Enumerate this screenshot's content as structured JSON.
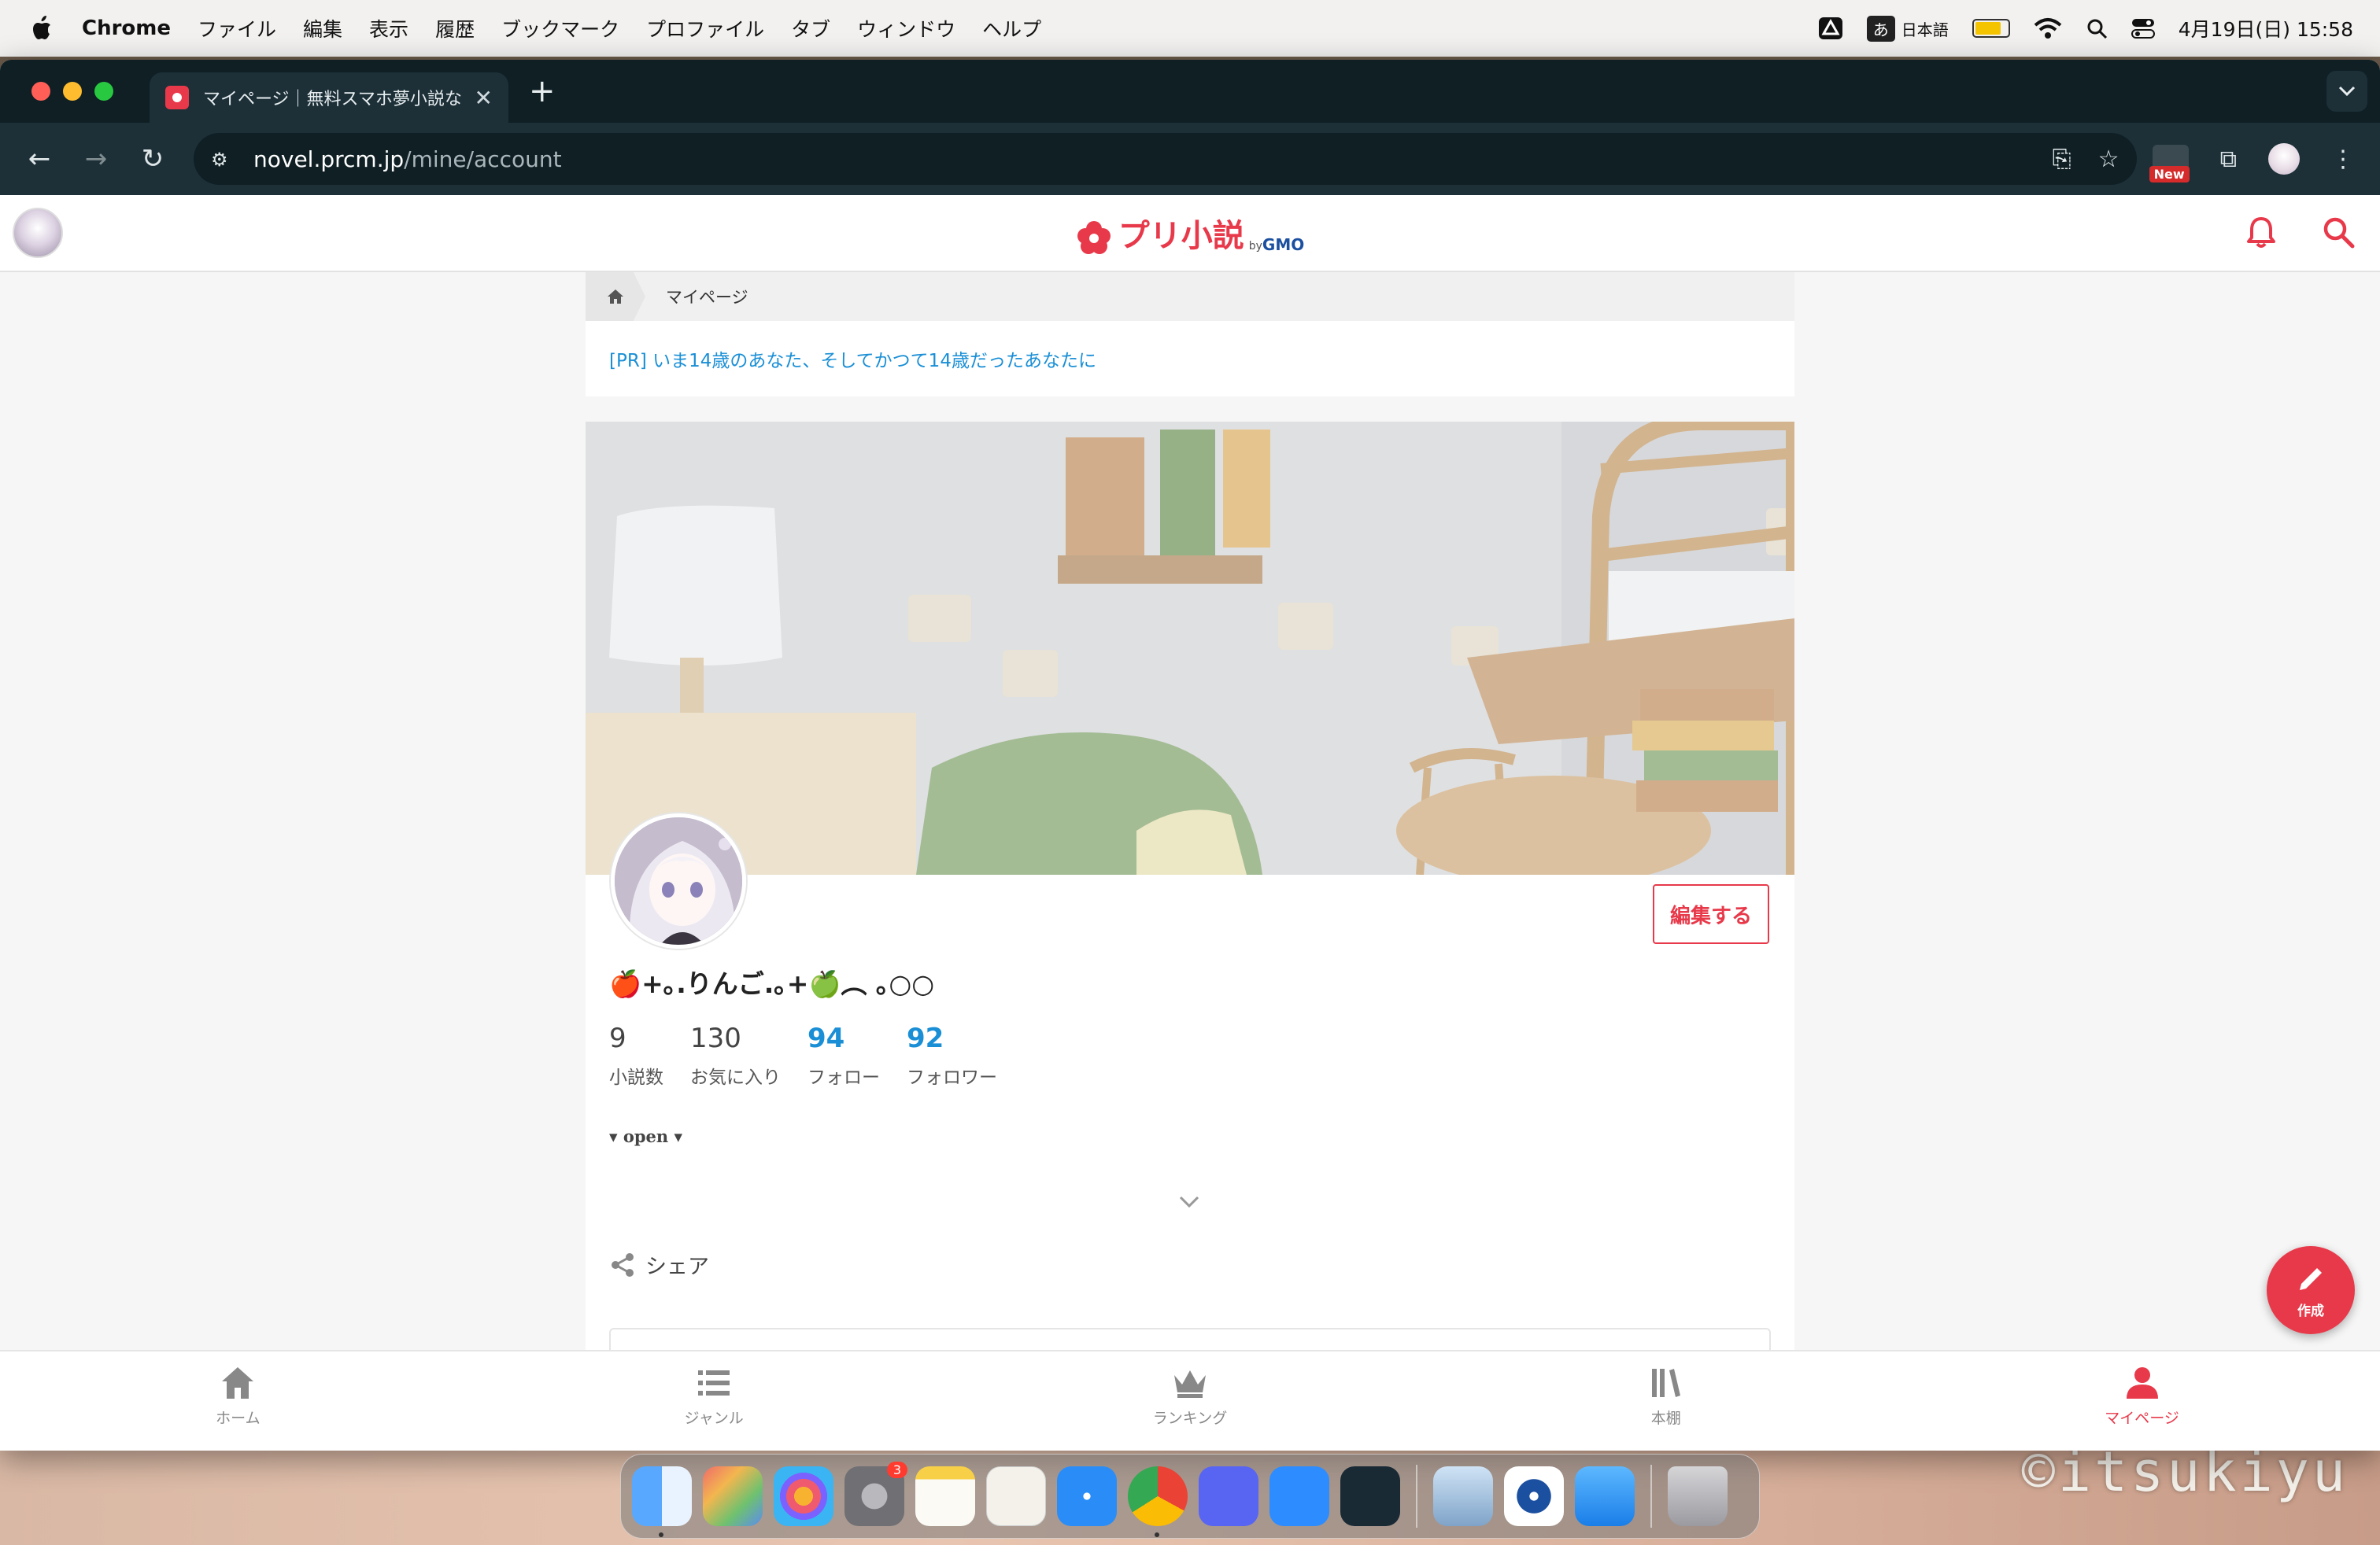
{
  "menubar": {
    "app_name": "Chrome",
    "items": [
      "ファイル",
      "編集",
      "表示",
      "履歴",
      "ブックマーク",
      "プロファイル",
      "タブ",
      "ウィンドウ",
      "ヘルプ"
    ],
    "ime_mode": "あ",
    "ime_label": "日本語",
    "datetime": "4月19日(日) 15:58"
  },
  "browser": {
    "tab_title": "マイページ｜無料スマホ夢小説な",
    "url_host": "novel.prcm.jp",
    "url_path": "/mine/account",
    "ext_badge": "New"
  },
  "site": {
    "logo_text": "プリ小説",
    "logo_by": "by",
    "logo_gmo": "GMO",
    "breadcrumb": "マイページ",
    "pr_link": "[PR] いま14歳のあなた、そしてかつて14歳だったあなたに"
  },
  "profile": {
    "username": "🍎+｡.りんご.｡+🍏︵ ｡○○",
    "edit_button": "編集する",
    "stats": [
      {
        "num": "9",
        "label": "小説数"
      },
      {
        "num": "130",
        "label": "お気に入り"
      },
      {
        "num": "94",
        "label": "フォロー"
      },
      {
        "num": "92",
        "label": "フォロワー"
      }
    ],
    "open_toggle": "open",
    "share_label": "シェア"
  },
  "bottom_nav": [
    {
      "label": "ホーム",
      "icon": "home-icon"
    },
    {
      "label": "ジャンル",
      "icon": "list-icon"
    },
    {
      "label": "ランキング",
      "icon": "crown-icon"
    },
    {
      "label": "本棚",
      "icon": "bookshelf-icon"
    },
    {
      "label": "マイページ",
      "icon": "person-icon"
    }
  ],
  "fab_label": "作成",
  "dock": {
    "settings_badge": "3"
  },
  "watermark": "©itsukiyu",
  "colors": {
    "brand": "#e8394a",
    "link": "#1a8fd6",
    "browser_dark": "#0f1f24",
    "browser_toolbar": "#1d3038"
  }
}
